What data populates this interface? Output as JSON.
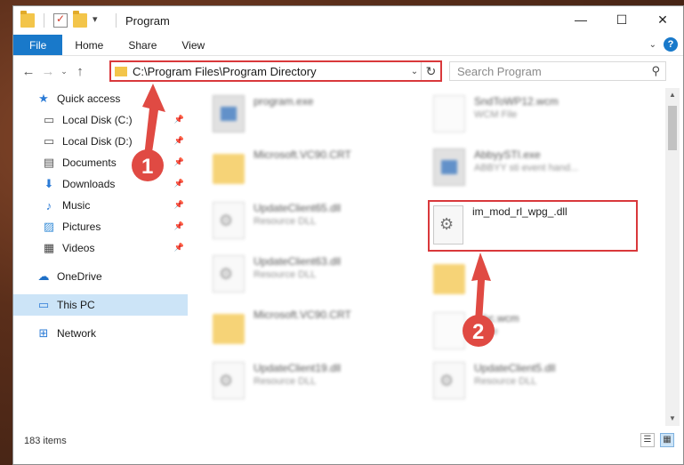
{
  "window": {
    "title": "Program",
    "controls": {
      "minimize": "—",
      "maximize": "☐",
      "close": "✕"
    }
  },
  "ribbon": {
    "tabs": [
      "File",
      "Home",
      "Share",
      "View"
    ]
  },
  "address": {
    "path": "C:\\Program Files\\Program Directory"
  },
  "search": {
    "placeholder": "Search Program"
  },
  "nav_pane": {
    "items": [
      {
        "label": "Quick access",
        "icon": "star-icon"
      },
      {
        "label": "Local Disk (C:)",
        "icon": "drive-icon",
        "pinned": true
      },
      {
        "label": "Local Disk (D:)",
        "icon": "drive-icon",
        "pinned": true
      },
      {
        "label": "Documents",
        "icon": "document-icon",
        "pinned": true
      },
      {
        "label": "Downloads",
        "icon": "download-icon",
        "pinned": true
      },
      {
        "label": "Music",
        "icon": "music-icon",
        "pinned": true
      },
      {
        "label": "Pictures",
        "icon": "picture-icon",
        "pinned": true
      },
      {
        "label": "Videos",
        "icon": "video-icon",
        "pinned": true
      },
      {
        "label": "OneDrive",
        "icon": "cloud-icon"
      },
      {
        "label": "This PC",
        "icon": "computer-icon"
      },
      {
        "label": "Network",
        "icon": "network-icon"
      }
    ]
  },
  "files": [
    {
      "name": "program.exe",
      "desc": ""
    },
    {
      "name": "SndToWP12.wcm",
      "desc": "WCM File"
    },
    {
      "name": "Microsoft.VC90.CRT",
      "desc": ""
    },
    {
      "name": "AbbyySTI.exe",
      "desc": "ABBYY sti event hand..."
    },
    {
      "name": "UpdateClient65.dll",
      "desc": "Resource DLL"
    },
    {
      "name": "im_mod_rl_wpg_.dll",
      "desc": ""
    },
    {
      "name": "UpdateClient63.dll",
      "desc": "Resource DLL"
    },
    {
      "name": "",
      "desc": ""
    },
    {
      "name": "Microsoft.VC90.CRT",
      "desc": ""
    },
    {
      "name": "...bc.wcm",
      "desc": "...File"
    },
    {
      "name": "UpdateClient19.dll",
      "desc": "Resource DLL"
    },
    {
      "name": "UpdateClient5.dll",
      "desc": "Resource DLL"
    }
  ],
  "status": {
    "item_count": "183 items"
  },
  "annotations": {
    "step1": "1",
    "step2": "2",
    "color": "#e04a43"
  }
}
